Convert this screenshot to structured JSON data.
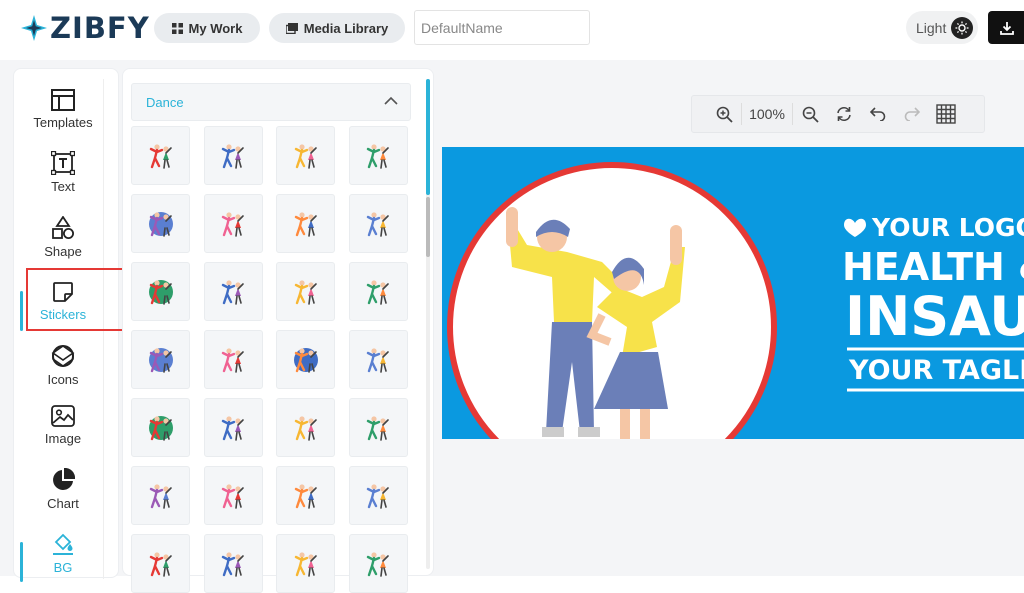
{
  "header": {
    "logo_text": "ZIBFY",
    "my_work_label": "My Work",
    "media_library_label": "Media Library",
    "name_placeholder": "DefaultName",
    "theme_label": "Light"
  },
  "tools": [
    {
      "label": "Templates",
      "icon": "templates-icon"
    },
    {
      "label": "Text",
      "icon": "text-icon"
    },
    {
      "label": "Shape",
      "icon": "shape-icon"
    },
    {
      "label": "Stickers",
      "icon": "stickers-icon",
      "active": true
    },
    {
      "label": "Icons",
      "icon": "icons-icon"
    },
    {
      "label": "Image",
      "icon": "image-icon"
    },
    {
      "label": "Chart",
      "icon": "chart-icon"
    },
    {
      "label": "BG",
      "icon": "bg-icon"
    }
  ],
  "stickers": {
    "category": "Dance"
  },
  "canvas_toolbar": {
    "zoom": "100%"
  },
  "design": {
    "logo_line": "YOUR LOGO",
    "line1": "HEALTH &",
    "line2": "INSAU",
    "tagline": "YOUR TAGLIN"
  },
  "colors": {
    "accent": "#2bb3d8",
    "design_bg": "#0a99e0",
    "highlight": "#e53935"
  }
}
